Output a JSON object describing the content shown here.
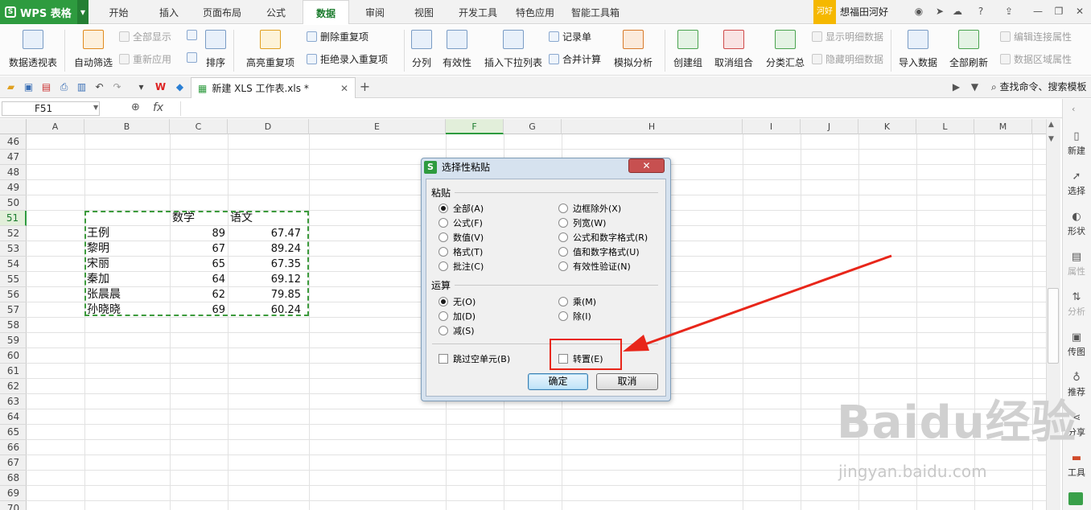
{
  "app": {
    "name": "WPS 表格"
  },
  "menu_tabs": [
    "开始",
    "插入",
    "页面布局",
    "公式",
    "数据",
    "审阅",
    "视图",
    "开发工具",
    "特色应用",
    "智能工具箱"
  ],
  "active_tab": "数据",
  "user": {
    "badge": "河好",
    "name": "想福田河好"
  },
  "ribbon": {
    "pivot": "数据透视表",
    "autofilter": "自动筛选",
    "show_all": "全部显示",
    "reapply": "重新应用",
    "sort": "排序",
    "highlight_dup": "高亮重复项",
    "remove_dup": "删除重复项",
    "reject_dup": "拒绝录入重复项",
    "split": "分列",
    "validity": "有效性",
    "dropdown": "插入下拉列表",
    "record": "记录单",
    "consolidate": "合并计算",
    "whatif": "模拟分析",
    "group": "创建组",
    "ungroup": "取消组合",
    "subtotal": "分类汇总",
    "show_detail": "显示明细数据",
    "hide_detail": "隐藏明细数据",
    "import": "导入数据",
    "refresh_all": "全部刷新",
    "edit_links": "编辑连接属性",
    "range_props": "数据区域属性"
  },
  "doc_tab": "新建 XLS 工作表.xls *",
  "search_cmd": "查找命令、搜索模板",
  "name_box": "F51",
  "fx": "fx",
  "columns": [
    "A",
    "B",
    "C",
    "D",
    "E",
    "F",
    "G",
    "H",
    "I",
    "J",
    "K",
    "L",
    "M"
  ],
  "rows": [
    "46",
    "47",
    "48",
    "49",
    "50",
    "51",
    "52",
    "53",
    "54",
    "55",
    "56",
    "57",
    "58",
    "59",
    "60",
    "61",
    "62",
    "63",
    "64",
    "65",
    "66",
    "67",
    "68",
    "69",
    "70"
  ],
  "table": {
    "header": [
      "数学",
      "语文"
    ],
    "data": [
      {
        "name": "王例",
        "math": "89",
        "chinese": "67.47"
      },
      {
        "name": "黎明",
        "math": "67",
        "chinese": "89.24"
      },
      {
        "name": "宋丽",
        "math": "65",
        "chinese": "67.35"
      },
      {
        "name": "秦加",
        "math": "64",
        "chinese": "69.12"
      },
      {
        "name": "张晨晨",
        "math": "62",
        "chinese": "79.85"
      },
      {
        "name": "孙晓晓",
        "math": "69",
        "chinese": "60.24"
      }
    ]
  },
  "sidebar": [
    "新建",
    "选择",
    "形状",
    "属性",
    "分析",
    "传图",
    "推荐",
    "分享",
    "工具"
  ],
  "dialog": {
    "title": "选择性粘贴",
    "paste_label": "粘贴",
    "paste_options": [
      "全部(A)",
      "公式(F)",
      "数值(V)",
      "格式(T)",
      "批注(C)"
    ],
    "paste_options_right": [
      "边框除外(X)",
      "列宽(W)",
      "公式和数字格式(R)",
      "值和数字格式(U)",
      "有效性验证(N)"
    ],
    "op_label": "运算",
    "op_options": [
      "无(O)",
      "加(D)",
      "减(S)"
    ],
    "op_options_right": [
      "乘(M)",
      "除(I)"
    ],
    "skip_blanks": "跳过空单元(B)",
    "transpose": "转置(E)",
    "ok": "确定",
    "cancel": "取消"
  },
  "watermark": {
    "main": "Baidu经验",
    "sub": "jingyan.baidu.com"
  },
  "colors": {
    "brand": "#2e9b3f",
    "arrow": "#e8261a"
  }
}
